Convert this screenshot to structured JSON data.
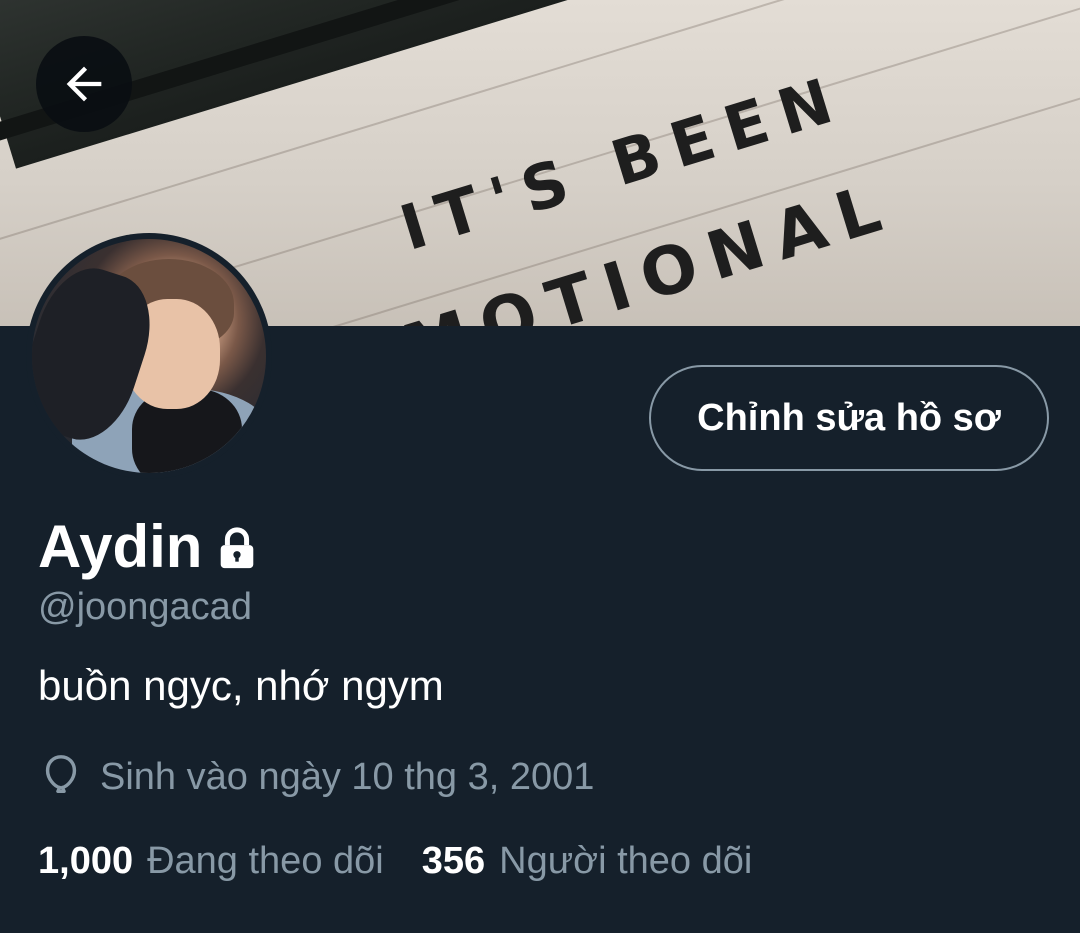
{
  "header": {
    "banner_text_line1": "IT'S BEEN",
    "banner_text_line2": "EMOTIONAL",
    "back_icon": "arrow-left-icon"
  },
  "profile": {
    "name": "Aydin",
    "protected_icon": "lock-icon",
    "handle": "@joongacad",
    "bio": "buồn ngyc, nhớ ngym",
    "birthday_icon": "balloon-icon",
    "birthday": "Sinh vào ngày 10 thg 3, 2001",
    "edit_button_label": "Chỉnh sửa hồ sơ"
  },
  "stats": {
    "following_count": "1,000",
    "following_label": "Đang theo dõi",
    "followers_count": "356",
    "followers_label": "Người theo dõi"
  },
  "colors": {
    "background": "#15202b",
    "secondary_text": "#8899a6",
    "primary_text": "#ffffff"
  }
}
